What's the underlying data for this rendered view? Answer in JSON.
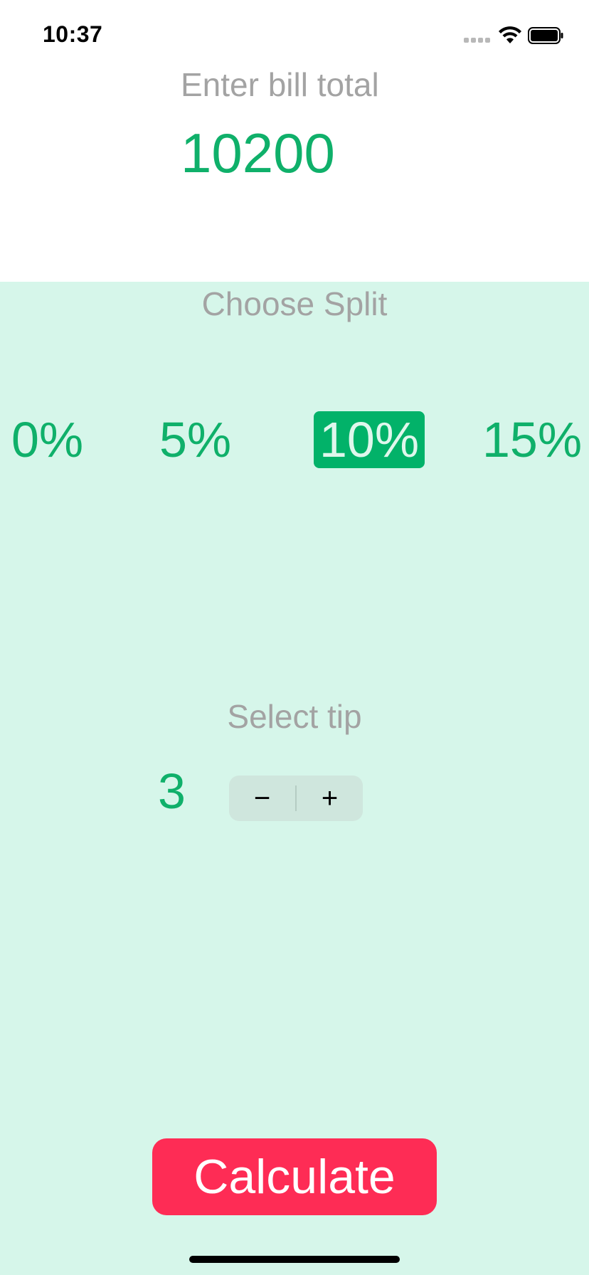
{
  "status_bar": {
    "time": "10:37"
  },
  "bill": {
    "label": "Enter bill total",
    "value": "10200"
  },
  "split": {
    "label": "Choose Split",
    "options": [
      "0%",
      "5%",
      "10%",
      "15%"
    ],
    "selected": "10%"
  },
  "tip": {
    "label": "Select tip",
    "value": "3",
    "decrement_label": "−",
    "increment_label": "+"
  },
  "calculate": {
    "label": "Calculate"
  },
  "colors": {
    "accent": "#0fb06a",
    "selected_bg": "#02b269",
    "background": "#d6f6ea",
    "button": "#fe2c55",
    "label_gray": "#a3a3a3"
  }
}
